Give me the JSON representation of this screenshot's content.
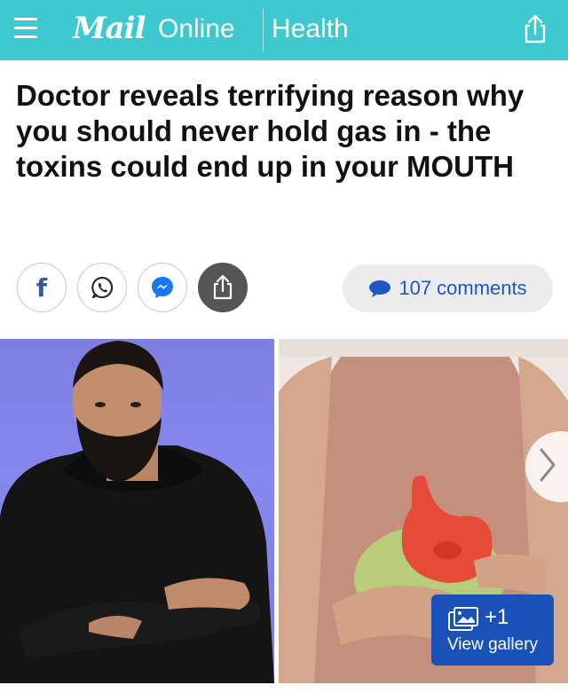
{
  "header": {
    "brand_mail": "Mail",
    "brand_online": "Online",
    "section": "Health",
    "bg_color": "#3ec8cf"
  },
  "article": {
    "headline": "Doctor reveals terrifying reason why you should never hold gas in - the toxins could end up in your MOUTH"
  },
  "social": {
    "facebook_glyph": "f",
    "icons": [
      "facebook-icon",
      "whatsapp-icon",
      "messenger-icon",
      "share-icon"
    ]
  },
  "comments": {
    "label": "107 comments",
    "color": "#1f57c2"
  },
  "gallery": {
    "count": "+1",
    "label": "View gallery",
    "color": "#1a51b8"
  }
}
